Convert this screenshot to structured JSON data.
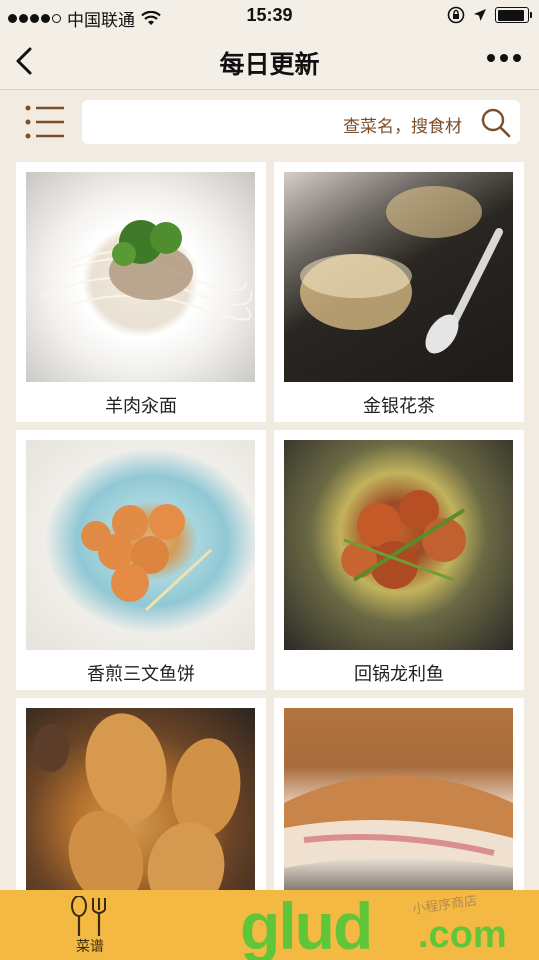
{
  "status_bar": {
    "carrier": "中国联通",
    "time": "15:39",
    "battery_level": 0.9
  },
  "nav": {
    "title": "每日更新"
  },
  "search": {
    "placeholder": "查菜名，搜食材"
  },
  "recipes": [
    {
      "name": "羊肉汆面"
    },
    {
      "name": "金银花茶"
    },
    {
      "name": "香煎三文鱼饼"
    },
    {
      "name": "回锅龙利鱼"
    },
    {
      "name": ""
    },
    {
      "name": ""
    }
  ],
  "tab_bar": {
    "items": [
      {
        "label": "菜谱",
        "icon": "fork-spoon-icon"
      }
    ]
  },
  "watermark": {
    "logo_text": "glud",
    "logo_suffix": ".com",
    "shop_text": "小程序商店"
  },
  "colors": {
    "accent_brown": "#7b4f2a",
    "tab_bar": "#f4b942",
    "background": "#f1ebe1",
    "watermark_green": "#5fc63a"
  }
}
